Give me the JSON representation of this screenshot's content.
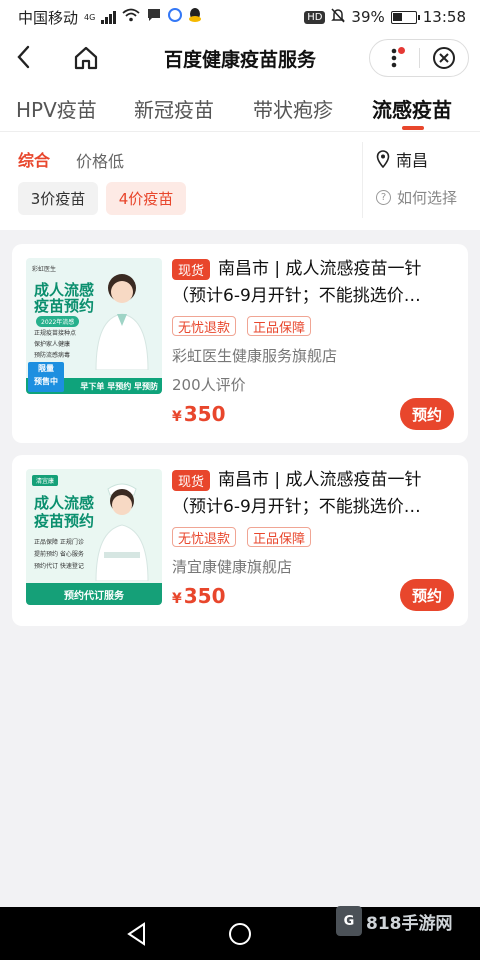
{
  "status_bar": {
    "carrier": "中国移动",
    "network": "4G",
    "battery": "39%",
    "time": "13:58",
    "hd": "HD"
  },
  "nav": {
    "title": "百度健康疫苗服务"
  },
  "tabs": [
    {
      "label": "HPV疫苗"
    },
    {
      "label": "新冠疫苗"
    },
    {
      "label": "带状疱疹"
    },
    {
      "label": "流感疫苗"
    }
  ],
  "filter": {
    "sort_default": "综合",
    "sort_price": "价格低",
    "location": "南昌",
    "chip_3": "3价疫苗",
    "chip_4": "4价疫苗",
    "how_to_choose": "如何选择"
  },
  "products": [
    {
      "tag": "现货",
      "title": "南昌市 | 成人流感疫苗一针（预计6-9月开针；不能挑选价…",
      "badges": [
        "无忧退款",
        "正品保障"
      ],
      "store": "彩虹医生健康服务旗舰店",
      "reviews": "200人评价",
      "currency": "¥",
      "price": "350",
      "button": "预约",
      "thumb": {
        "brand": "彩虹医生",
        "heading": [
          "成人流感",
          "疫苗预约"
        ],
        "year": "2022年流感",
        "bullets": [
          "正规疫苗接种点",
          "保护家人健康",
          "预防流感病毒"
        ],
        "limited": "限量",
        "presale": "预售中",
        "footer": "早下单 早预约 早预防"
      }
    },
    {
      "tag": "现货",
      "title": "南昌市 | 成人流感疫苗一针（预计6-9月开针；不能挑选价…",
      "badges": [
        "无忧退款",
        "正品保障"
      ],
      "store": "清宜康健康旗舰店",
      "currency": "¥",
      "price": "350",
      "button": "预约",
      "thumb": {
        "brand": "清宜康",
        "heading": [
          "成人流感",
          "疫苗预约"
        ],
        "bullets": [
          "正品保障 正规门诊",
          "提前预约 省心服务",
          "预约代订 快速登记"
        ],
        "footer": "预约代订服务"
      }
    }
  ],
  "watermark": "818手游网",
  "colors": {
    "accent": "#e8462c",
    "brand_green": "#0fa37b"
  }
}
